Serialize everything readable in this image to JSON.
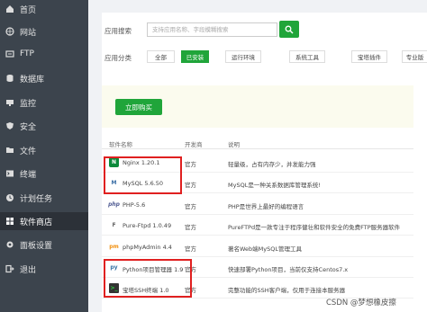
{
  "sidebar": {
    "items": [
      {
        "label": "首页",
        "icon": "home-icon"
      },
      {
        "label": "网站",
        "icon": "globe-icon"
      },
      {
        "label": "FTP",
        "icon": "ftp-icon"
      },
      {
        "label": "数据库",
        "icon": "database-icon"
      },
      {
        "label": "监控",
        "icon": "monitor-icon"
      },
      {
        "label": "安全",
        "icon": "shield-icon"
      },
      {
        "label": "文件",
        "icon": "folder-icon"
      },
      {
        "label": "终端",
        "icon": "terminal-icon"
      },
      {
        "label": "计划任务",
        "icon": "clock-icon"
      },
      {
        "label": "软件商店",
        "icon": "grid-icon"
      },
      {
        "label": "面板设置",
        "icon": "settings-icon"
      },
      {
        "label": "退出",
        "icon": "logout-icon"
      }
    ],
    "active_index": 9
  },
  "search": {
    "label": "应用搜索",
    "placeholder": "支持应用名称、字段模糊搜索"
  },
  "categories": {
    "label": "应用分类",
    "items": [
      "全部",
      "已安装",
      "运行环境",
      "系统工具",
      "宝塔插件",
      "专业版"
    ],
    "active_index": 1
  },
  "promo": {
    "button": "立即购买"
  },
  "table": {
    "headers": [
      "软件名称",
      "开发商",
      "说明"
    ],
    "rows": [
      {
        "name": "Nginx 1.20.1",
        "dev": "官方",
        "desc": "轻量级，占有内存少，并发能力强",
        "logo": "N"
      },
      {
        "name": "MySQL 5.6.50",
        "dev": "官方",
        "desc": "MySQL是一种关系数据库管理系统!",
        "logo": "M"
      },
      {
        "name": "PHP-5.6",
        "dev": "官方",
        "desc": "PHP是世界上最好的编程语言",
        "logo": "php"
      },
      {
        "name": "Pure-Ftpd 1.0.49",
        "dev": "官方",
        "desc": "PureFTPd是一款专注于程序健壮和软件安全的免费FTP服务器软件",
        "logo": "F"
      },
      {
        "name": "phpMyAdmin 4.4",
        "dev": "官方",
        "desc": "著名Web端MySQL管理工具",
        "logo": "pm"
      },
      {
        "name": "Python项目管理器 1.9",
        "dev": "官方",
        "desc": "快速部署Python项目，当前仅支持Centos7.x",
        "logo": "py"
      },
      {
        "name": "宝塔SSH终端 1.0",
        "dev": "官方",
        "desc": "完整功能的SSH客户端，仅用于连接本服务器",
        "logo": ">_"
      }
    ]
  },
  "watermark": "CSDN @梦想橡皮擦",
  "colors": {
    "accent": "#20a53a",
    "sidebar_bg": "#3c444d",
    "highlight": "#e02020"
  }
}
